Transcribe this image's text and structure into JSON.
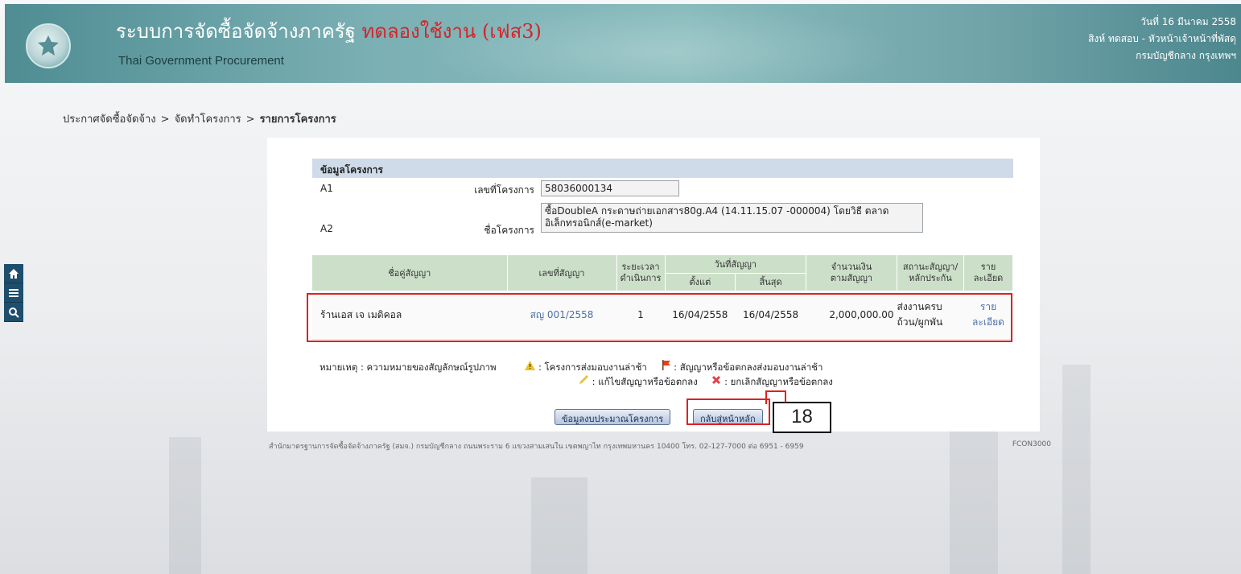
{
  "header": {
    "title_main": "ระบบการจัดซื้อจัดจ้างภาครัฐ",
    "title_tag": "ทดลองใช้งาน (เฟส3)",
    "subtitle": "Thai Government Procurement",
    "date": "วันที่ 16 มีนาคม 2558",
    "user": "สิงห์ ทดสอบ - หัวหน้าเจ้าหน้าที่พัสดุ",
    "department": "กรมบัญชีกลาง กรุงเทพฯ",
    "logo_text": "กรมบัญชีกลาง"
  },
  "breadcrumb": {
    "item1": "ประกาศจัดซื้อจัดจ้าง",
    "item2": "จัดทำโครงการ",
    "item3": "รายการโครงการ",
    "separator": ">"
  },
  "sidebar": {
    "icons": [
      "home-icon",
      "menu-icon",
      "search-icon"
    ]
  },
  "project": {
    "section_title": "ข้อมูลโครงการ",
    "a1_code": "A1",
    "a2_code": "A2",
    "number_label": "เลขที่โครงการ",
    "number_value": "58036000134",
    "name_label": "ชื่อโครงการ",
    "name_line1": "ซื้อDoubleA กระดาษถ่ายเอกสาร80g.A4 (14.11.15.07 -000004) โดยวิธี ตลาด",
    "name_line2": "อิเล็กทรอนิกส์(e-market)"
  },
  "table": {
    "headers": {
      "party": "ชื่อคู่สัญญา",
      "contract_no": "เลขที่สัญญา",
      "duration_1": "ระยะเวลา",
      "duration_2": "ดำเนินการ",
      "date_group": "วันที่สัญญา",
      "date_from": "ตั้งแต่",
      "date_to": "สิ้นสุด",
      "amount_1": "จำนวนเงิน",
      "amount_2": "ตามสัญญา",
      "status_1": "สถานะสัญญา/",
      "status_2": "หลักประกัน",
      "detail_1": "ราย",
      "detail_2": "ละเอียด"
    },
    "row": {
      "party": "ร้านเอส เจ เมดิคอล",
      "contract_no": "สญ 001/2558",
      "duration": "1",
      "date_from": "16/04/2558",
      "date_to": "16/04/2558",
      "amount": "2,000,000.00",
      "status_1": "ส่งงานครบ",
      "status_2": "ถ้วน/ผูกพัน",
      "detail_1": "ราย",
      "detail_2": "ละเอียด"
    }
  },
  "legend": {
    "label": "หมายเหตุ : ความหมายของสัญลักษณ์รูปภาพ",
    "late_project": ": โครงการส่งมอบงานล่าช้า",
    "late_contract": ": สัญญาหรือข้อตกลงส่งมอบงานล่าช้า",
    "edit_contract": ": แก้ไขสัญญาหรือข้อตกลง",
    "cancel_contract": ": ยกเลิกสัญญาหรือข้อตกลง"
  },
  "buttons": {
    "budget": "ข้อมูลงบประมาณโครงการ",
    "back_home": "กลับสู่หน้าหลัก"
  },
  "annotation": {
    "step_number": "18"
  },
  "footer": {
    "text": "สำนักมาตรฐานการจัดซื้อจัดจ้างภาครัฐ (สมจ.) กรมบัญชีกลาง ถนนพระราม 6 แขวงสามเสนใน เขตพญาไท กรุงเทพมหานคร 10400 โทร. 02-127-7000 ต่อ 6951 - 6959",
    "page_code": "FCON3000"
  },
  "colors": {
    "header_teal": "#6fa3a8",
    "title_red": "#d4242a",
    "table_header_green": "#cce0c9",
    "section_blue": "#cfdbe8",
    "highlight_red": "#e02020",
    "link_blue": "#4d6fa8"
  }
}
